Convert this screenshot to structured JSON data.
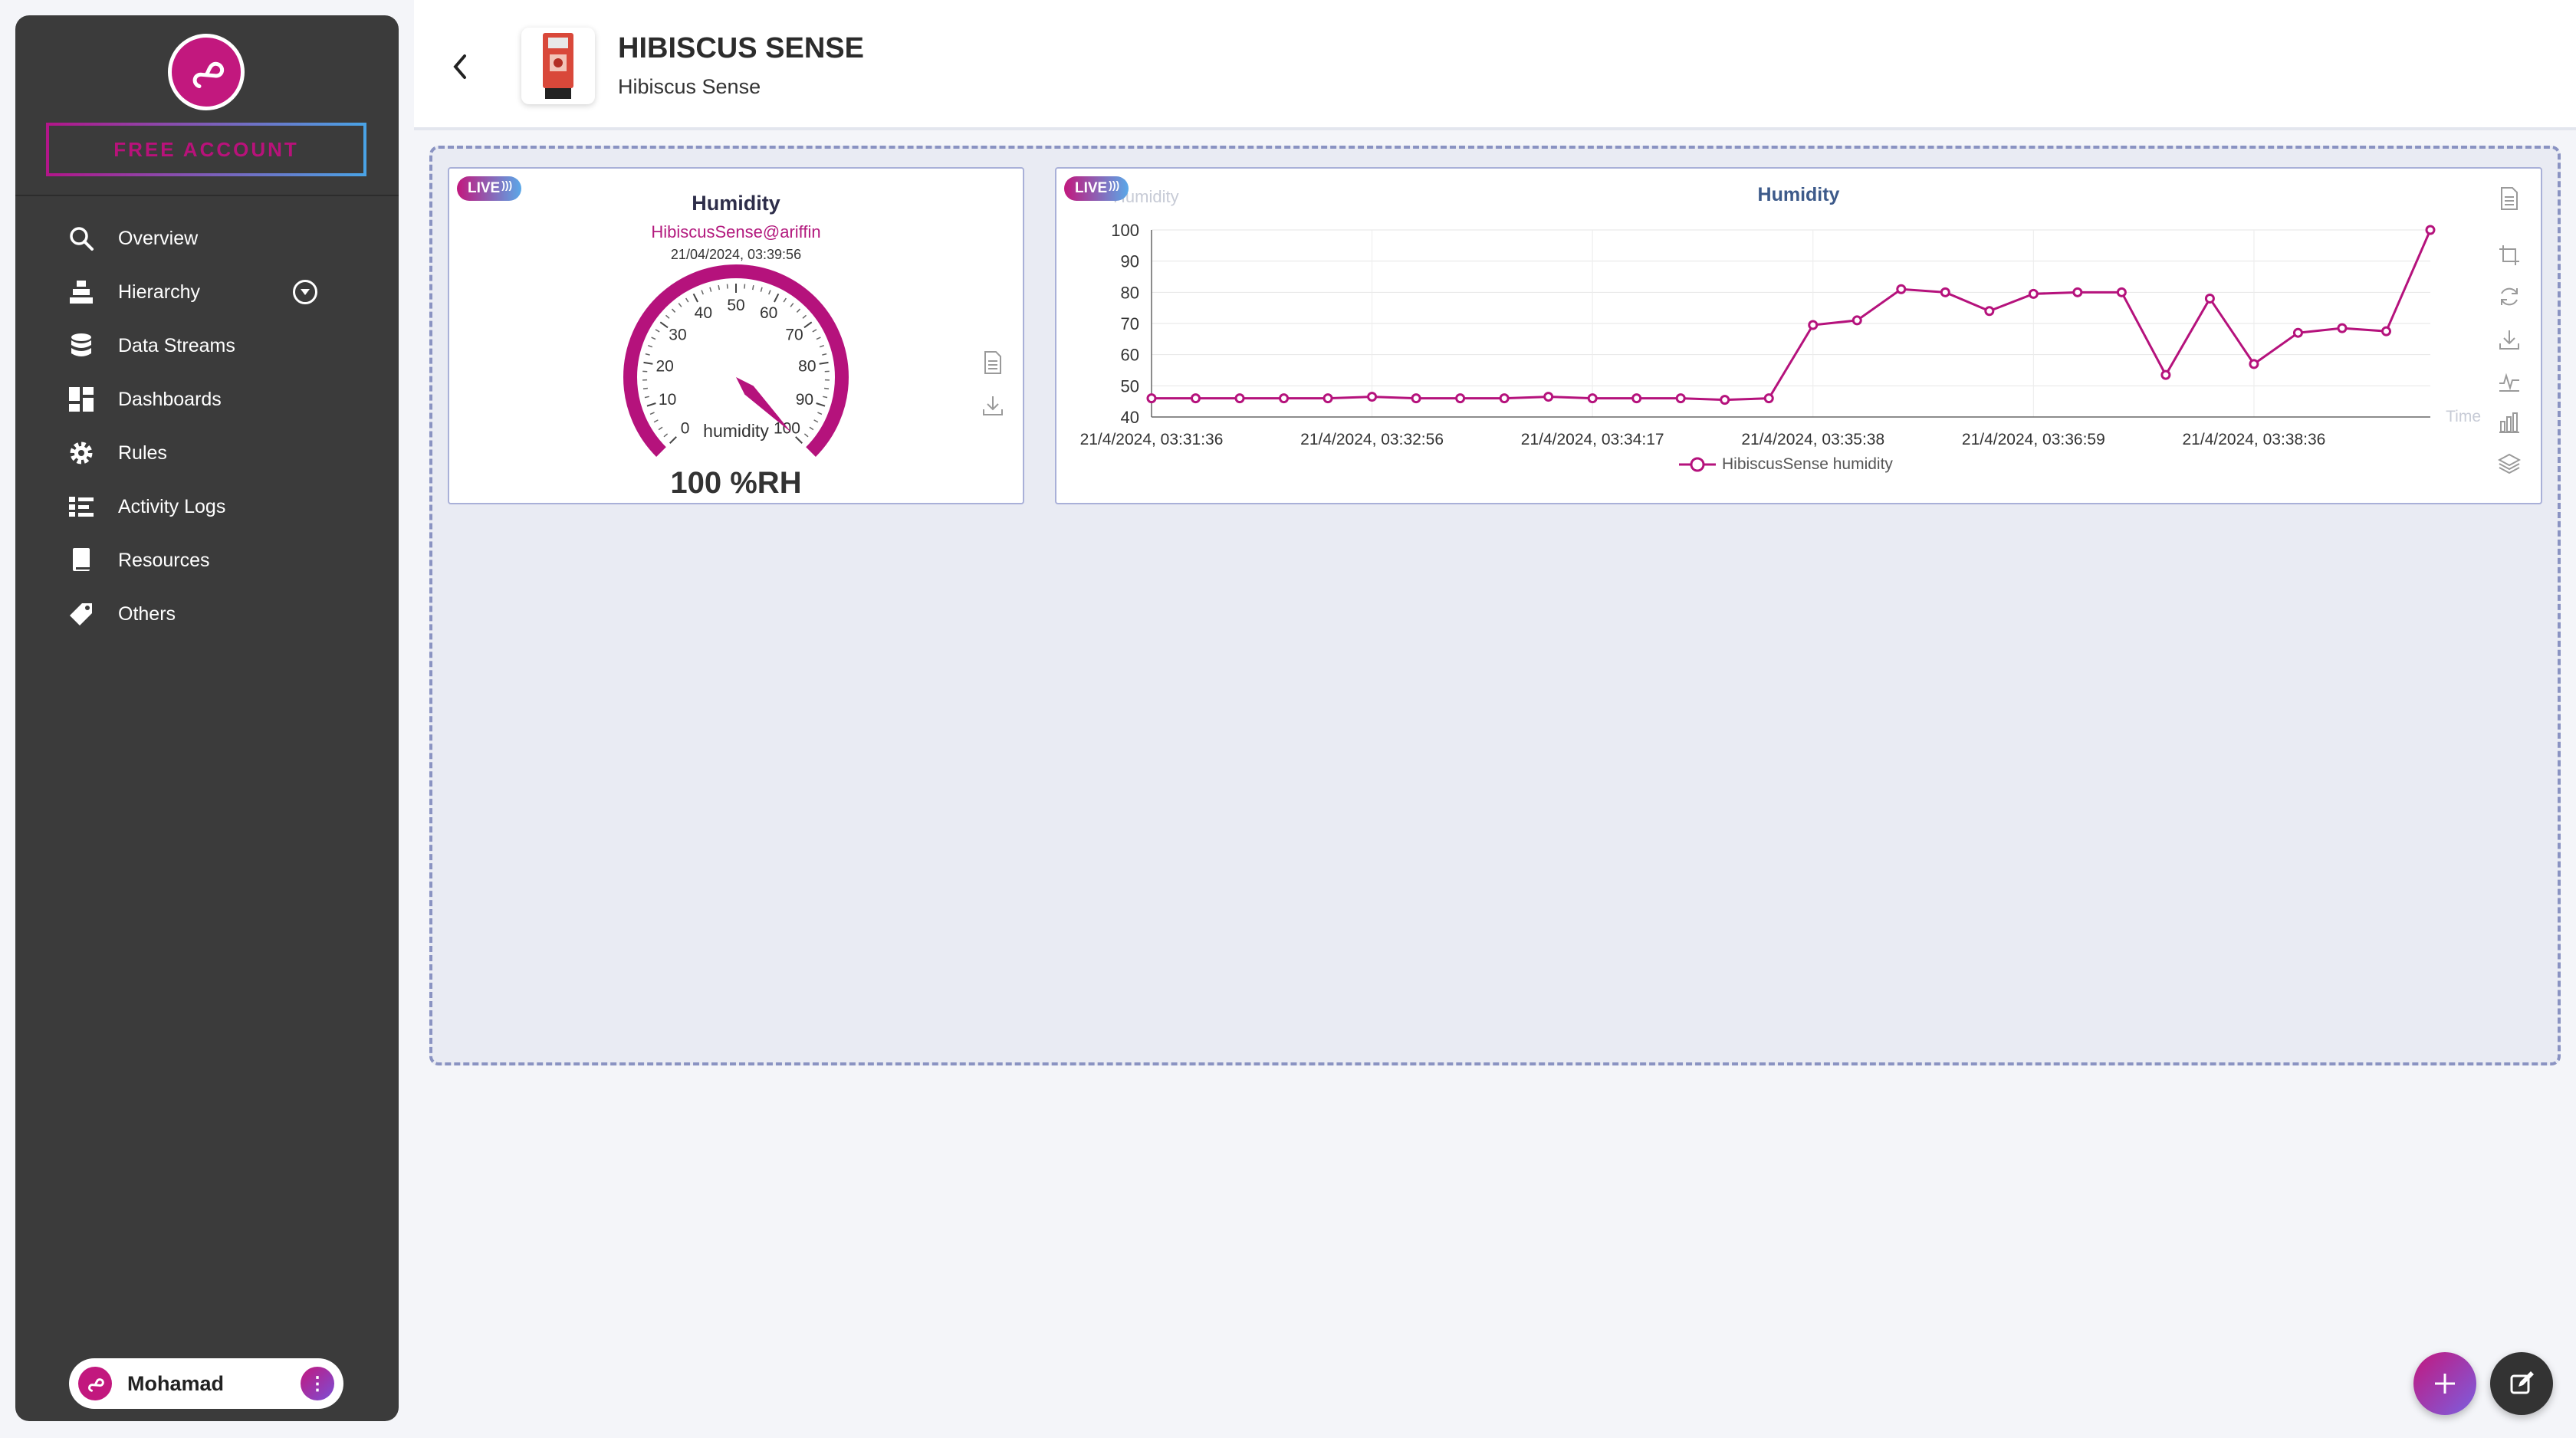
{
  "sidebar": {
    "account_button": "FREE ACCOUNT",
    "items": [
      {
        "label": "Overview",
        "icon": "search-icon"
      },
      {
        "label": "Hierarchy",
        "icon": "hierarchy-icon"
      },
      {
        "label": "Data Streams",
        "icon": "database-icon"
      },
      {
        "label": "Dashboards",
        "icon": "dashboard-icon"
      },
      {
        "label": "Rules",
        "icon": "gear-icon"
      },
      {
        "label": "Activity Logs",
        "icon": "list-icon"
      },
      {
        "label": "Resources",
        "icon": "book-icon"
      },
      {
        "label": "Others",
        "icon": "tag-icon"
      }
    ],
    "user": {
      "name": "Mohamad"
    }
  },
  "header": {
    "title": "HIBISCUS SENSE",
    "subtitle": "Hibiscus Sense"
  },
  "gauge_widget": {
    "badge": "LIVE",
    "title": "Humidity",
    "owner": "HibiscusSense@ariffin",
    "timestamp": "21/04/2024, 03:39:56",
    "label": "humidity",
    "value_text": "100 %RH",
    "value": 100,
    "ticks": [
      "0",
      "10",
      "20",
      "30",
      "40",
      "50",
      "60",
      "70",
      "80",
      "90",
      "100"
    ]
  },
  "chart_widget": {
    "badge": "LIVE",
    "ghost_label": "Humidity",
    "time_label": "Time",
    "legend": "HibiscusSense humidity"
  },
  "colors": {
    "accent": "#b5127c",
    "sidebar": "#3b3b3b",
    "chart_title": "#3d5a8a"
  },
  "chart_data": {
    "type": "line",
    "title": "Humidity",
    "xlabel": "Time",
    "ylabel": "Humidity",
    "ylim": [
      40,
      100
    ],
    "yticks": [
      40,
      50,
      60,
      70,
      80,
      90,
      100
    ],
    "xtick_labels": [
      "21/4/2024, 03:31:36",
      "21/4/2024, 03:32:56",
      "21/4/2024, 03:34:17",
      "21/4/2024, 03:35:38",
      "21/4/2024, 03:36:59",
      "21/4/2024, 03:38:36"
    ],
    "legend_position": "bottom",
    "series": [
      {
        "name": "HibiscusSense humidity",
        "values": [
          46,
          46,
          46,
          46,
          46,
          46.5,
          46,
          46,
          46,
          46.5,
          46,
          46,
          46,
          45.5,
          46,
          69.5,
          71,
          81,
          80,
          74,
          79.5,
          80,
          80,
          53.5,
          78,
          57,
          67,
          68.5,
          67.5,
          100
        ]
      }
    ]
  }
}
